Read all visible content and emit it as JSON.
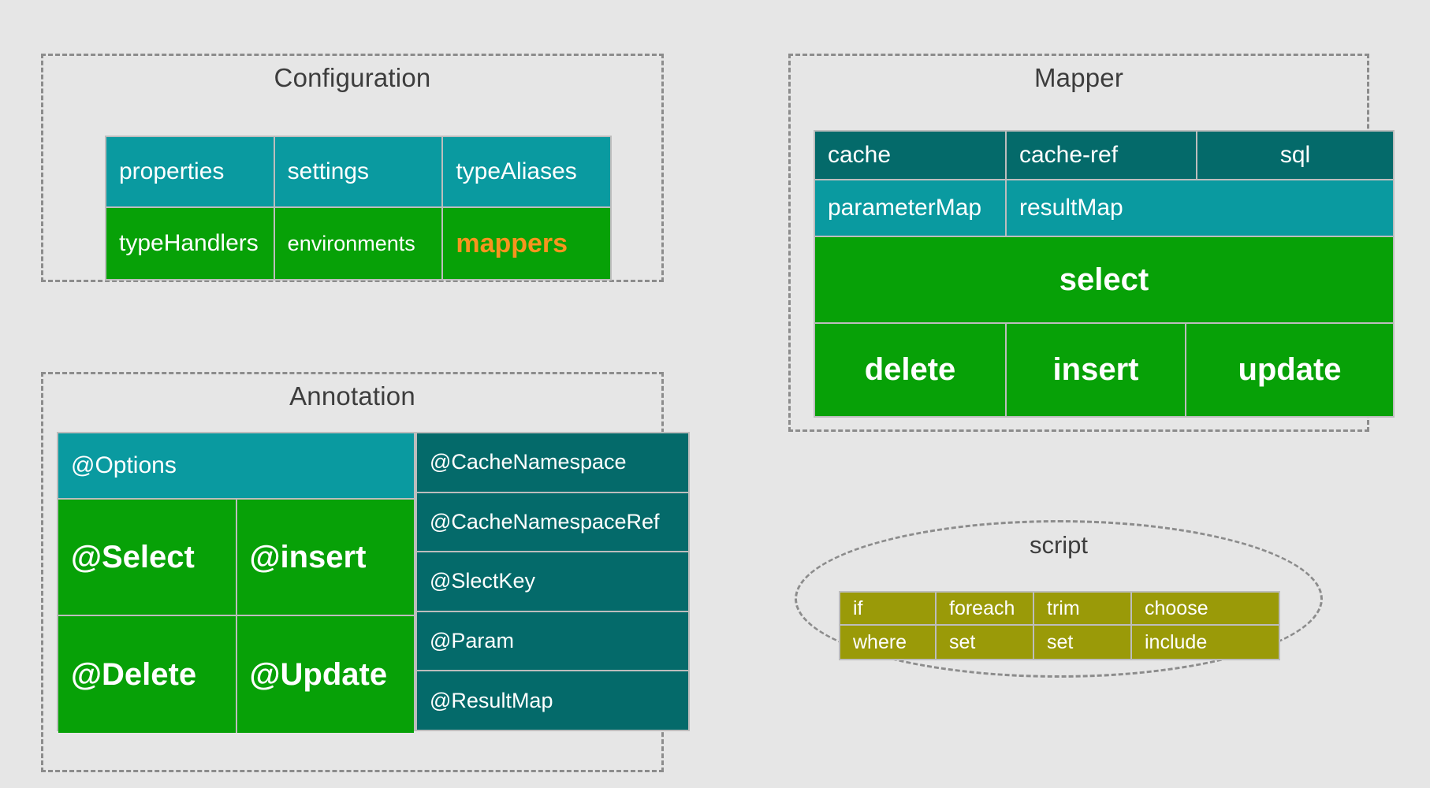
{
  "colors": {
    "background": "#e6e6e6",
    "teal": "#0a9aa0",
    "dark_teal": "#046a6a",
    "green": "#07a107",
    "olive": "#9a9a08",
    "orange_accent": "#f7941e",
    "dashed_border": "#8c8c8c",
    "cell_border": "#bdbdbd",
    "title_text": "#3d3d3d"
  },
  "groups": {
    "configuration": {
      "title": "Configuration"
    },
    "annotation": {
      "title": "Annotation"
    },
    "mapper": {
      "title": "Mapper"
    },
    "script": {
      "title": "script"
    }
  },
  "configuration_table": {
    "rows": [
      [
        {
          "label": "properties",
          "fill": "teal",
          "style": "md"
        },
        {
          "label": "settings",
          "fill": "teal",
          "style": "md"
        },
        {
          "label": "typeAliases",
          "fill": "teal",
          "style": "md"
        }
      ],
      [
        {
          "label": "typeHandlers",
          "fill": "green",
          "style": "md"
        },
        {
          "label": "environments",
          "fill": "green",
          "style": "sm"
        },
        {
          "label": "mappers",
          "fill": "green",
          "style": "lg-orange"
        }
      ]
    ]
  },
  "mapper_table": {
    "rows": [
      [
        {
          "label": "cache",
          "fill": "dark_teal",
          "style": "md",
          "align": "left"
        },
        {
          "label": "cache-ref",
          "fill": "dark_teal",
          "style": "md",
          "align": "left"
        },
        {
          "label": "sql",
          "fill": "dark_teal",
          "style": "md",
          "align": "center"
        }
      ],
      [
        {
          "label": "parameterMap",
          "fill": "teal",
          "style": "md",
          "align": "left"
        },
        {
          "label": "resultMap",
          "fill": "teal",
          "style": "md",
          "align": "left"
        }
      ],
      [
        {
          "label": "select",
          "fill": "green",
          "style": "xl",
          "align": "center"
        }
      ],
      [
        {
          "label": "delete",
          "fill": "green",
          "style": "xl",
          "align": "center"
        },
        {
          "label": "insert",
          "fill": "green",
          "style": "xl",
          "align": "center"
        },
        {
          "label": "update",
          "fill": "green",
          "style": "xl",
          "align": "center"
        }
      ]
    ]
  },
  "annotation_left_table": {
    "rows": [
      [
        {
          "label": "@Options",
          "fill": "teal",
          "style": "md"
        }
      ],
      [
        {
          "label": "@Select",
          "fill": "green",
          "style": "xl"
        },
        {
          "label": "@insert",
          "fill": "green",
          "style": "xl"
        }
      ],
      [
        {
          "label": "@Delete",
          "fill": "green",
          "style": "xl"
        },
        {
          "label": "@Update",
          "fill": "green",
          "style": "xl"
        }
      ]
    ]
  },
  "annotation_right_table": {
    "rows": [
      [
        {
          "label": "@CacheNamespace",
          "fill": "dark_teal",
          "style": "sm"
        }
      ],
      [
        {
          "label": "@CacheNamespaceRef",
          "fill": "dark_teal",
          "style": "sm"
        }
      ],
      [
        {
          "label": "@SlectKey",
          "fill": "dark_teal",
          "style": "sm"
        }
      ],
      [
        {
          "label": "@Param",
          "fill": "dark_teal",
          "style": "sm"
        }
      ],
      [
        {
          "label": "@ResultMap",
          "fill": "dark_teal",
          "style": "sm"
        }
      ]
    ]
  },
  "script_table": {
    "rows": [
      [
        {
          "label": "if",
          "fill": "olive"
        },
        {
          "label": "foreach",
          "fill": "olive"
        },
        {
          "label": "trim",
          "fill": "olive"
        },
        {
          "label": "choose",
          "fill": "olive"
        }
      ],
      [
        {
          "label": "where",
          "fill": "olive"
        },
        {
          "label": "set",
          "fill": "olive"
        },
        {
          "label": "set",
          "fill": "olive"
        },
        {
          "label": "include",
          "fill": "olive"
        }
      ]
    ]
  }
}
